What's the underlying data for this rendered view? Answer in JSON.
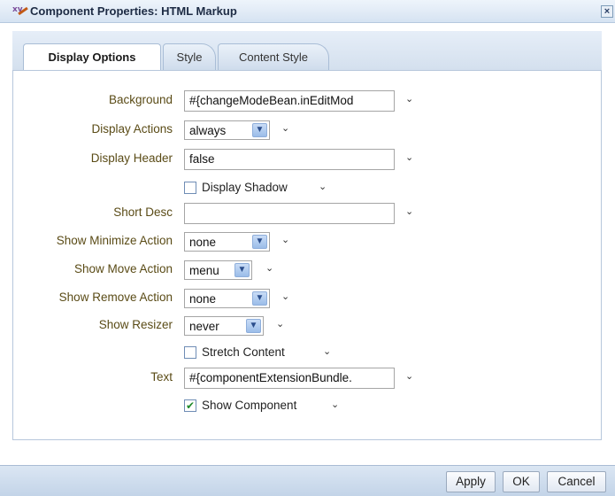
{
  "window": {
    "title": "Component Properties: HTML Markup",
    "close_glyph": "×"
  },
  "tabs": [
    {
      "label": "Display Options",
      "active": true
    },
    {
      "label": "Style",
      "active": false
    },
    {
      "label": "Content Style",
      "active": false
    }
  ],
  "fields": {
    "background": {
      "label": "Background",
      "value": "#{changeModeBean.inEditMod"
    },
    "display_actions": {
      "label": "Display Actions",
      "value": "always"
    },
    "display_header": {
      "label": "Display Header",
      "value": "false"
    },
    "display_shadow": {
      "label": "Display Shadow",
      "checked": false
    },
    "short_desc": {
      "label": "Short Desc",
      "value": ""
    },
    "show_minimize_action": {
      "label": "Show Minimize Action",
      "value": "none"
    },
    "show_move_action": {
      "label": "Show Move Action",
      "value": "menu"
    },
    "show_remove_action": {
      "label": "Show Remove Action",
      "value": "none"
    },
    "show_resizer": {
      "label": "Show Resizer",
      "value": "never"
    },
    "stretch_content": {
      "label": "Stretch Content",
      "checked": false
    },
    "text": {
      "label": "Text",
      "value": "#{componentExtensionBundle."
    },
    "show_component": {
      "label": "Show Component",
      "checked": true
    }
  },
  "glyphs": {
    "dropdown": "▼",
    "chevron": "⌄",
    "check": "✔"
  },
  "buttons": {
    "apply": "Apply",
    "ok": "OK",
    "cancel": "Cancel"
  },
  "colors": {
    "label_text": "#5a4b16",
    "title_bar": "#d6e3f2",
    "footer": "#c3d4e8"
  },
  "icons": {
    "title": "edit-properties-icon"
  }
}
